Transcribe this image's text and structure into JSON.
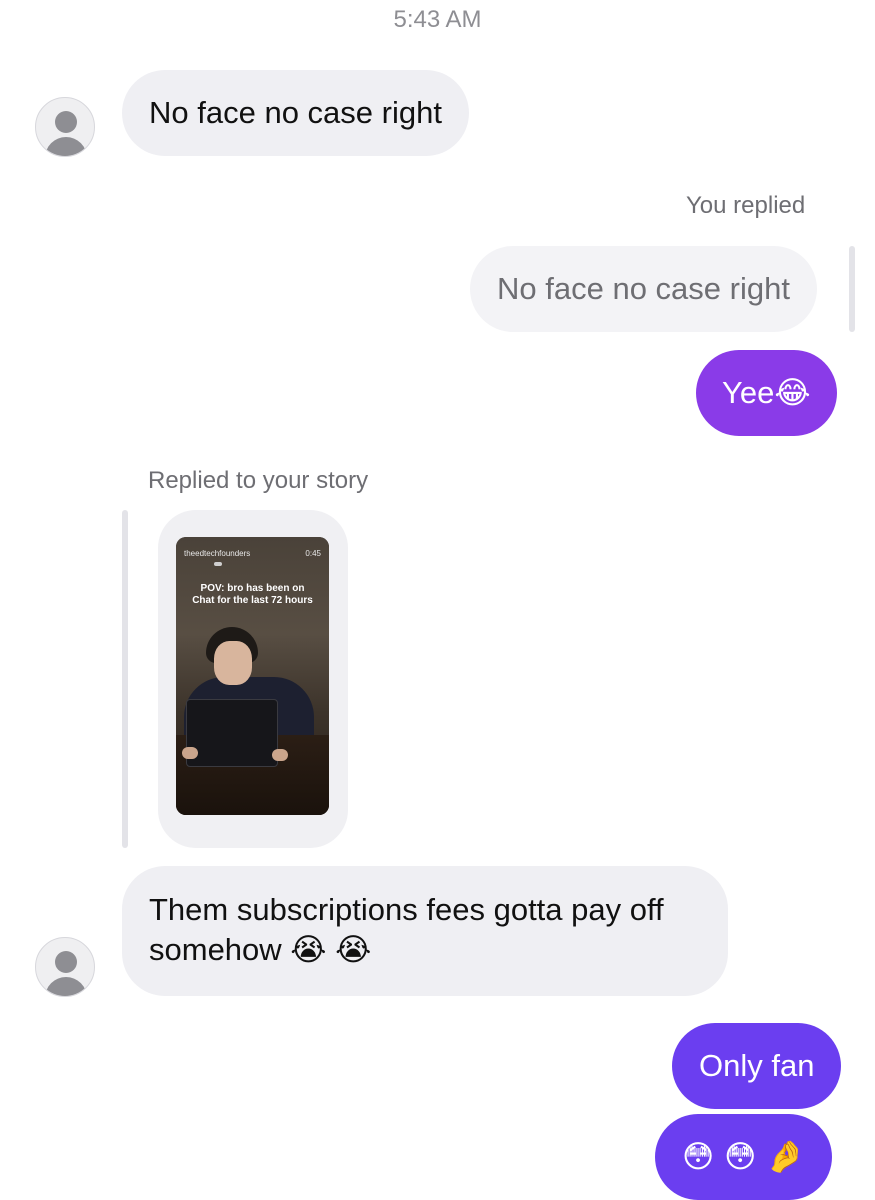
{
  "header": {
    "timestamp": "5:43 AM"
  },
  "messages": {
    "m1": {
      "text": "No face no case right",
      "sender": "them"
    },
    "reply_label": "You replied",
    "quoted": "No face no case right",
    "m2": {
      "text": "Yee😂",
      "sender": "me"
    },
    "story_label": "Replied to your story",
    "story": {
      "username": "theedtechfounders",
      "duration": "0:45",
      "caption": "POV: bro has been on Chat for the last 72 hours"
    },
    "m3": {
      "text": "Them subscriptions fees gotta pay off somehow 😭 😭",
      "sender": "them"
    },
    "m4": {
      "text": "Only fan",
      "sender": "me"
    },
    "m5": {
      "text": "😳 😳 🤌",
      "sender": "me"
    }
  },
  "colors": {
    "incoming_bubble": "#efeff3",
    "outgoing_purple": "#8a3be8",
    "outgoing_indigo": "#6b3ef0"
  }
}
